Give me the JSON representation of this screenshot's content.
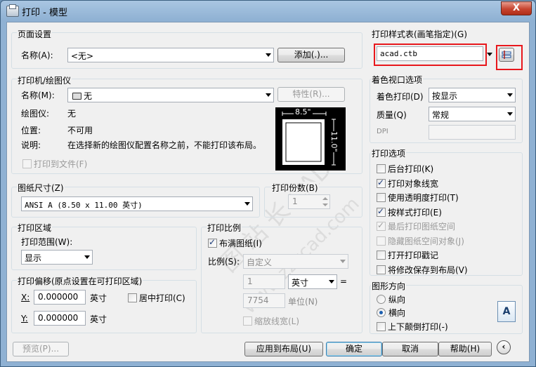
{
  "window": {
    "title": "打印 - 模型",
    "close_glyph": "X"
  },
  "page_setup": {
    "group_label": "页面设置",
    "name_label": "名称(A):",
    "name_value": "<无>",
    "add_button": "添加(.)..."
  },
  "printer": {
    "group_label": "打印机/绘图仪",
    "name_label": "名称(M):",
    "name_value": "无",
    "properties_button": "特性(R)...",
    "plotter_label": "绘图仪:",
    "plotter_value": "无",
    "location_label": "位置:",
    "location_value": "不可用",
    "description_label": "说明:",
    "description_value": "在选择新的绘图仪配置名称之前，不能打印该布局。",
    "print_to_file": "打印到文件(F)",
    "preview_width": "8.5\"",
    "preview_height": "11.0\""
  },
  "paper_size": {
    "group_label": "图纸尺寸(Z)",
    "value": "ANSI A (8.50 x 11.00 英寸)"
  },
  "copies": {
    "group_label": "打印份数(B)",
    "value": "1"
  },
  "plot_area": {
    "group_label": "打印区域",
    "range_label": "打印范围(W):",
    "range_value": "显示"
  },
  "plot_offset": {
    "group_label": "打印偏移(原点设置在可打印区域)",
    "x_label": "X:",
    "x_value": "0.000000",
    "x_unit": "英寸",
    "y_label": "Y:",
    "y_value": "0.000000",
    "y_unit": "英寸",
    "center_label": "居中打印(C)"
  },
  "plot_scale": {
    "group_label": "打印比例",
    "fit_label": "布满图纸(I)",
    "scale_label": "比例(S):",
    "scale_value": "自定义",
    "value1": "1",
    "unit_value": "英寸",
    "equals": "=",
    "value2": "7754",
    "unit2_label": "单位(N)",
    "scale_lineweights": "缩放线宽(L)"
  },
  "plot_style_table": {
    "group_label": "打印样式表(画笔指定)(G)",
    "value": "acad.ctb"
  },
  "shaded_viewport": {
    "group_label": "着色视口选项",
    "shade_label": "着色打印(D)",
    "shade_value": "按显示",
    "quality_label": "质量(Q)",
    "quality_value": "常规",
    "dpi_label": "DPI"
  },
  "plot_options": {
    "group_label": "打印选项",
    "items": [
      {
        "label": "后台打印(K)",
        "checked": false,
        "disabled": false
      },
      {
        "label": "打印对象线宽",
        "checked": true,
        "disabled": false
      },
      {
        "label": "使用透明度打印(T)",
        "checked": false,
        "disabled": false
      },
      {
        "label": "按样式打印(E)",
        "checked": true,
        "disabled": false
      },
      {
        "label": "最后打印图纸空间",
        "checked": true,
        "disabled": true
      },
      {
        "label": "隐藏图纸空间对象(J)",
        "checked": false,
        "disabled": true
      },
      {
        "label": "打开打印戳记",
        "checked": false,
        "disabled": false
      },
      {
        "label": "将修改保存到布局(V)",
        "checked": false,
        "disabled": false
      }
    ]
  },
  "orientation": {
    "group_label": "图形方向",
    "portrait": "纵向",
    "landscape": "横向",
    "upside_down": "上下颠倒打印(-)",
    "icon_letter": "A"
  },
  "footer": {
    "preview": "预览(P)...",
    "apply_layout": "应用到布局(U)",
    "ok": "确定",
    "cancel": "取消",
    "help": "帮助(H)"
  },
  "colors": {
    "highlight_red": "#e8171c",
    "title_bar": "#8fb1d3",
    "dialog_bg": "#f0f0f0"
  }
}
